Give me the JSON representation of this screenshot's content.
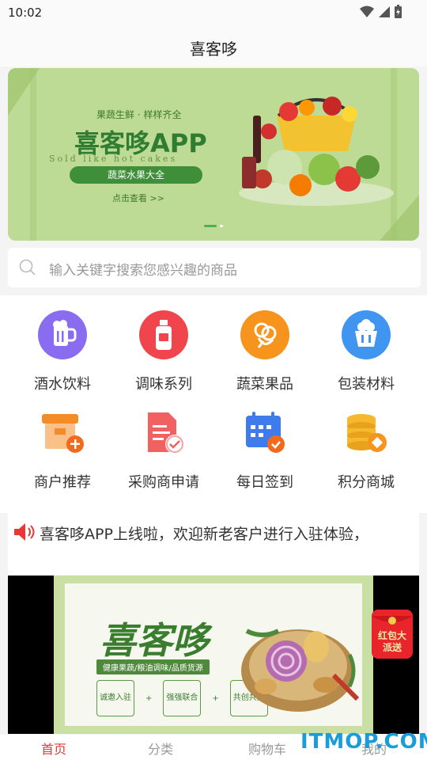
{
  "status_bar": {
    "time": "10:02"
  },
  "header": {
    "title": "喜客哆"
  },
  "banner": {
    "tag": "果蔬生鲜 · 样样齐全",
    "headline": "喜客哆APP",
    "script_text": "Sold like hot cakes",
    "pill": "蔬菜水果大全",
    "link": "点击查看 >>"
  },
  "search": {
    "placeholder": "输入关键字搜索您感兴趣的商品"
  },
  "categories": [
    {
      "label": "酒水饮料",
      "icon": "beer-mug-icon",
      "color": "#8a6cf0"
    },
    {
      "label": "调味系列",
      "icon": "seasoning-bottle-icon",
      "color": "#f0454c"
    },
    {
      "label": "蔬菜果品",
      "icon": "vegetable-icon",
      "color": "#f7941d"
    },
    {
      "label": "包装材料",
      "icon": "package-basket-icon",
      "color": "#3f95f0"
    },
    {
      "label": "商户推荐",
      "icon": "store-plus-icon",
      "color": "#f28c28"
    },
    {
      "label": "采购商申请",
      "icon": "document-check-icon",
      "color": "#f26161"
    },
    {
      "label": "每日签到",
      "icon": "calendar-check-icon",
      "color": "#3f7bec"
    },
    {
      "label": "积分商城",
      "icon": "coins-icon",
      "color": "#f5b82e"
    }
  ],
  "notice": {
    "text": "喜客哆APP上线啦，欢迎新老客户进行入驻体验，"
  },
  "promo": {
    "title": "喜客哆",
    "subtitle": "健康果蔬/粮油调味/品质货源",
    "boxes": [
      "诚邀入驻",
      "强强联合",
      "共创共赢"
    ],
    "plus": "+"
  },
  "red_packet": {
    "label": "红包大派送"
  },
  "tabbar": {
    "items": [
      "首页",
      "分类",
      "购物车",
      "我的"
    ],
    "active_index": 0
  },
  "watermark": "ITMOP.COM",
  "colors": {
    "accent": "#e53935",
    "brand_green": "#3f8f3a"
  }
}
